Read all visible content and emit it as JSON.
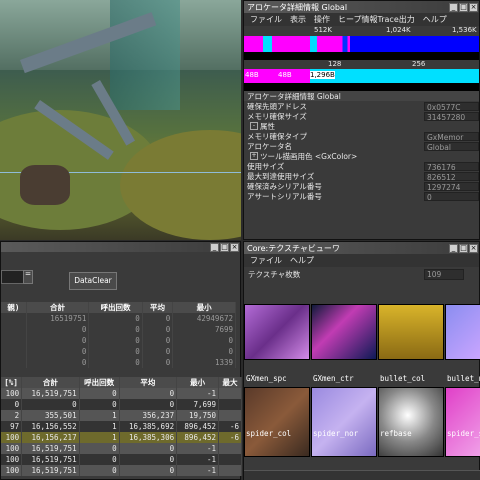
{
  "allocator_window": {
    "title": "アロケータ詳細情報 Global",
    "menu": [
      "ファイル",
      "表示",
      "操作",
      "ヒープ情報Trace出力",
      "ヘルプ"
    ],
    "scale1": [
      "512K",
      "1,024K",
      "1,536K"
    ],
    "scale2": [
      "128",
      "256"
    ],
    "scale3": [
      "48B",
      "48B",
      "1,296B"
    ],
    "section_title": "アロケータ詳細情報 Global",
    "props": [
      {
        "key": "確保先頭アドレス",
        "val": "0x0577C"
      },
      {
        "key": "メモリ確保サイズ",
        "val": "31457280"
      },
      {
        "key": "属性",
        "val": ""
      },
      {
        "key": "メモリ確保タイプ",
        "val": "GxMemor"
      },
      {
        "key": "アロケータ名",
        "val": "Global"
      },
      {
        "key": "ツール描画用色 <GxColor>",
        "val": ""
      },
      {
        "key": "使用サイズ",
        "val": "736176"
      },
      {
        "key": "最大到達使用サイズ",
        "val": "826512"
      },
      {
        "key": "確保済みシリアル番号",
        "val": "1297274"
      },
      {
        "key": "アサートシリアル番号",
        "val": "0"
      }
    ]
  },
  "stats_window": {
    "dataclear_label": "DataClear",
    "headers1": [
      "親)",
      "合計",
      "呼出回数",
      "平均",
      "最小"
    ],
    "rows1": [
      [
        "",
        "16519751",
        "0",
        "0",
        "42949672"
      ],
      [
        "",
        "0",
        "0",
        "0",
        "7699"
      ],
      [
        "",
        "0",
        "0",
        "0",
        "0"
      ],
      [
        "",
        "0",
        "0",
        "0",
        "0"
      ],
      [
        "",
        "0",
        "0",
        "0",
        "1339"
      ]
    ],
    "headers2": [
      "[%]",
      "合計",
      "呼出回数",
      "平均",
      "最小",
      "最大"
    ],
    "rows2": [
      [
        "100",
        "16,519,751",
        "0",
        "0",
        "-1",
        ""
      ],
      [
        "0",
        "0",
        "0",
        "0",
        "7,699",
        ""
      ],
      [
        "2",
        "355,501",
        "1",
        "356,237",
        "19,750",
        ""
      ],
      [
        "97",
        "16,156,552",
        "1",
        "16,385,692",
        "896,452",
        "-6"
      ],
      [
        "100",
        "16,156,217",
        "1",
        "16,385,306",
        "896,452",
        "-6"
      ],
      [
        "100",
        "16,519,751",
        "0",
        "0",
        "-1",
        ""
      ],
      [
        "100",
        "16,519,751",
        "0",
        "0",
        "-1",
        ""
      ],
      [
        "100",
        "16,519,751",
        "0",
        "0",
        "-1",
        ""
      ]
    ]
  },
  "texture_window": {
    "title": "Core:テクスチャビューワ",
    "menu": [
      "ファイル",
      "ヘルプ"
    ],
    "count_label": "テクスチャ枚数",
    "count_value": "109",
    "thumbs": [
      "GXmen_spc",
      "GXmen_ctr",
      "bullet_col",
      "bullet_nor",
      "spider_col",
      "spider_nor",
      "refbase",
      "spider_sp"
    ]
  }
}
